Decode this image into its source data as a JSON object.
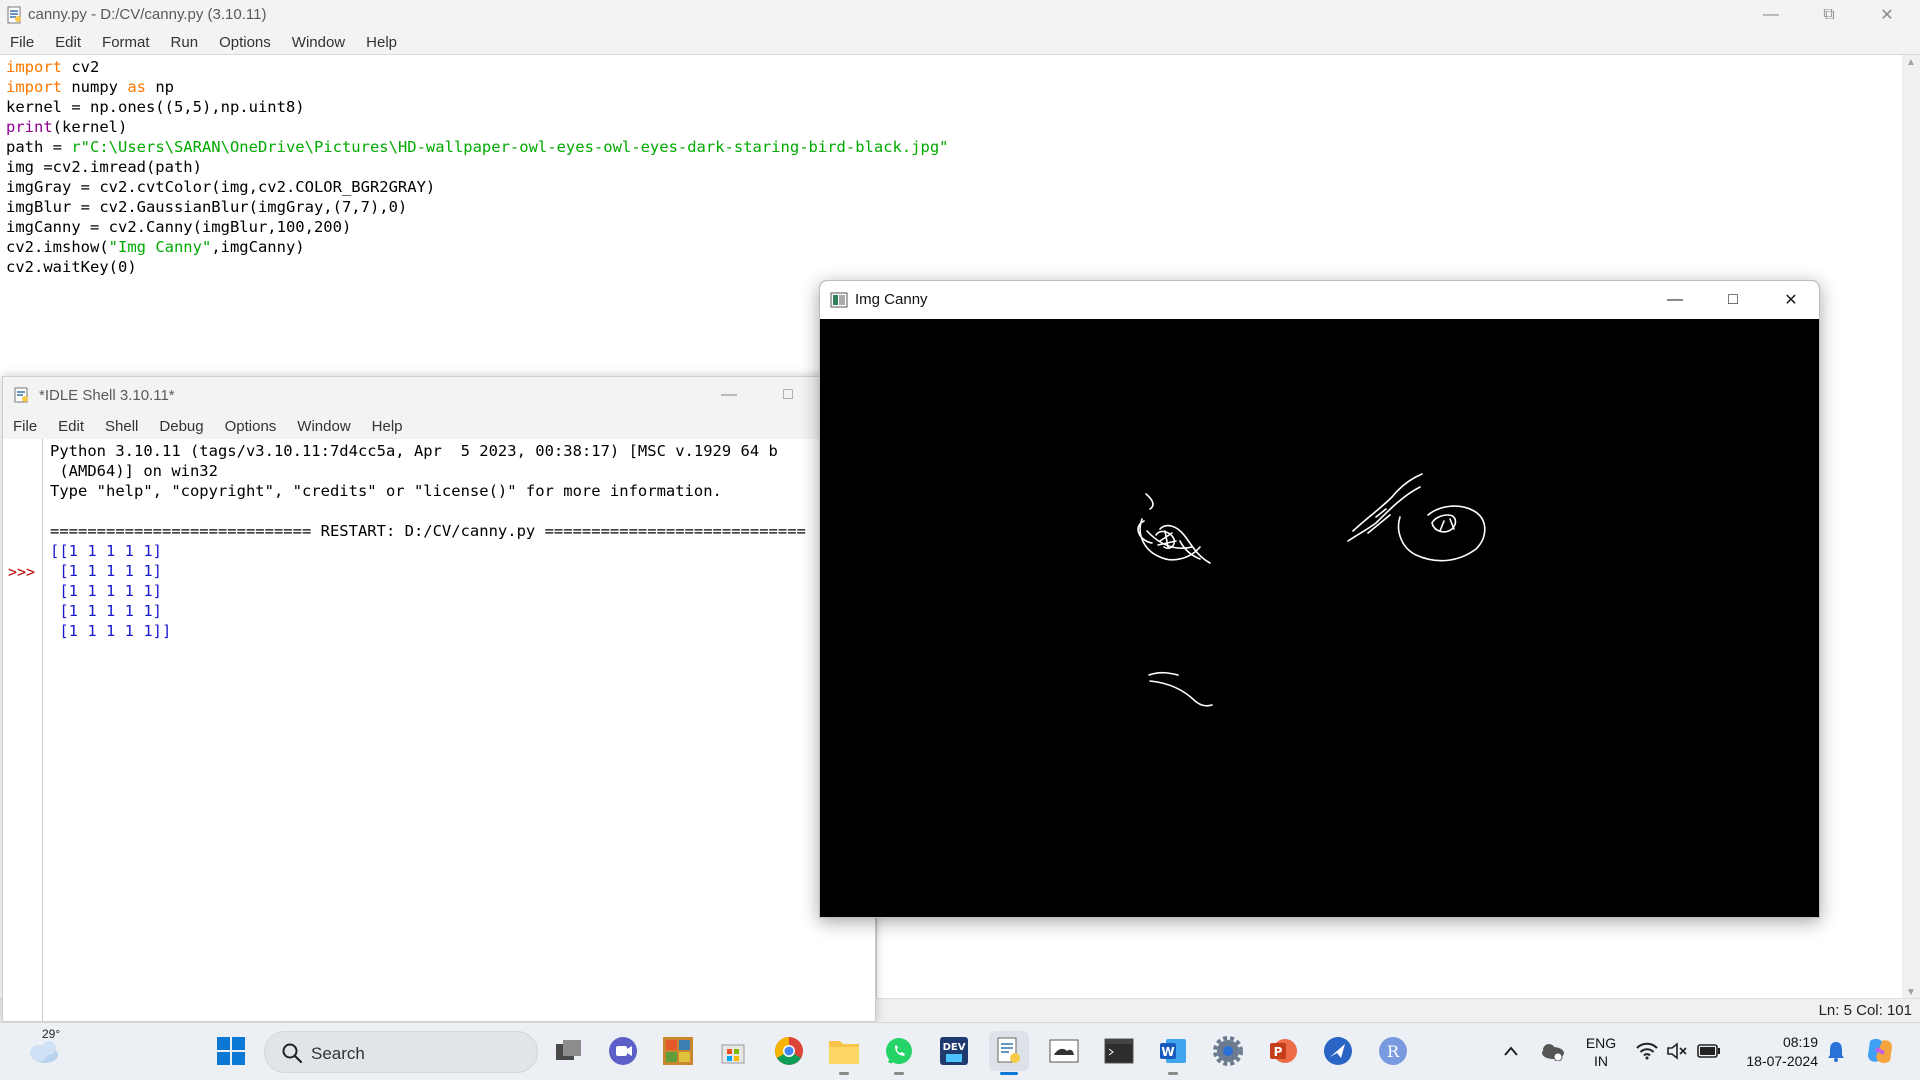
{
  "editor": {
    "title": "canny.py - D:/CV/canny.py (3.10.11)",
    "menu": [
      "File",
      "Edit",
      "Format",
      "Run",
      "Options",
      "Window",
      "Help"
    ],
    "code": {
      "l1_kw": "import",
      "l1_rest": " cv2",
      "l2_kw": "import",
      "l2_mid": " numpy ",
      "l2_kw2": "as",
      "l2_rest": " np",
      "l3": "kernel = np.ones((5,5),np.uint8)",
      "l4_fn": "print",
      "l4_rest": "(kernel)",
      "l5_pre": "path = ",
      "l5_str": "r\"C:\\Users\\SARAN\\OneDrive\\Pictures\\HD-wallpaper-owl-eyes-owl-eyes-dark-staring-bird-black.jpg\"",
      "l6": "img =cv2.imread(path)",
      "l7": "imgGray = cv2.cvtColor(img,cv2.COLOR_BGR2GRAY)",
      "l8": "imgBlur = cv2.GaussianBlur(imgGray,(7,7),0)",
      "l9": "imgCanny = cv2.Canny(imgBlur,100,200)",
      "l10_pre": "cv2.imshow(",
      "l10_str": "\"Img Canny\"",
      "l10_rest": ",imgCanny)",
      "l11": "cv2.waitKey(0)"
    },
    "status": "Ln: 5   Col: 101"
  },
  "shell": {
    "title": "*IDLE Shell 3.10.11*",
    "menu": [
      "File",
      "Edit",
      "Shell",
      "Debug",
      "Options",
      "Window",
      "Help"
    ],
    "prompt": ">>>",
    "lines": [
      "Python 3.10.11 (tags/v3.10.11:7d4cc5a, Apr  5 2023, 00:38:17) [MSC v.1929 64 b",
      " (AMD64)] on win32",
      "Type \"help\", \"copyright\", \"credits\" or \"license()\" for more information.",
      "",
      "============================ RESTART: D:/CV/canny.py ============================"
    ],
    "output": [
      "[[1 1 1 1 1]",
      " [1 1 1 1 1]",
      " [1 1 1 1 1]",
      " [1 1 1 1 1]",
      " [1 1 1 1 1]]"
    ]
  },
  "canny_window": {
    "title": "Img Canny"
  },
  "taskbar": {
    "weather_temp": "29°",
    "search_label": "Search",
    "lang_top": "ENG",
    "lang_bottom": "IN",
    "time": "08:19",
    "date": "18-07-2024",
    "apps": [
      "task-view",
      "meet",
      "photos",
      "store",
      "chrome",
      "file-explorer",
      "whatsapp",
      "dev-home",
      "idle",
      "capture",
      "terminal",
      "word",
      "settings",
      "powerpoint",
      "feedback",
      "profile-r"
    ]
  },
  "colors": {
    "keyword": "#ff7700",
    "builtin": "#900090",
    "string": "#00aa00",
    "output": "#1a1ad0",
    "prompt": "#c00000"
  }
}
